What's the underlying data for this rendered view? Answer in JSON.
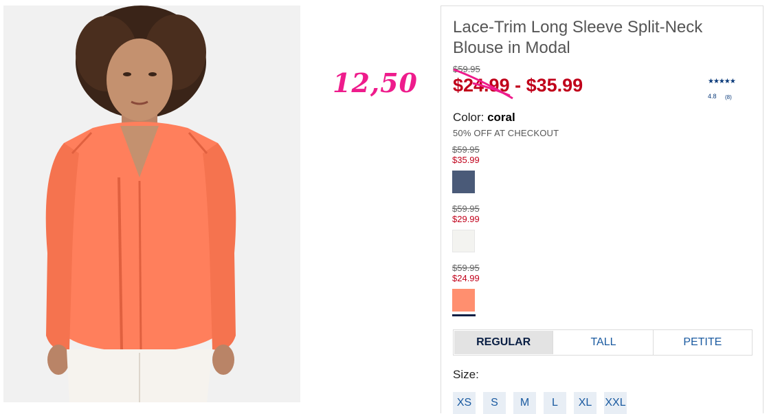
{
  "annotation": {
    "text": "12,50",
    "color": "#ee1c8c"
  },
  "product": {
    "title": "Lace-Trim Long Sleeve Split-Neck Blouse in Modal",
    "original_price": "$59.95",
    "sale_price_range": "$24.99 - $35.99",
    "rating": {
      "value": "4.8",
      "count": "(8)",
      "stars": "★★★★★"
    }
  },
  "color": {
    "label": "Color:",
    "selected": "coral",
    "promo": "50% OFF AT CHECKOUT",
    "swatches": [
      {
        "original": "$59.95",
        "sale": "$35.99",
        "color": "#4a5a78",
        "name": "navy"
      },
      {
        "original": "$59.95",
        "sale": "$29.99",
        "color": "#f3f3f0",
        "name": "white"
      },
      {
        "original": "$59.95",
        "sale": "$24.99",
        "color": "#ff8f6f",
        "name": "coral",
        "selected": true
      }
    ]
  },
  "fit": {
    "tabs": [
      "REGULAR",
      "TALL",
      "PETITE"
    ],
    "active": "REGULAR"
  },
  "size": {
    "label": "Size:",
    "options": [
      "XS",
      "S",
      "M",
      "L",
      "XL",
      "XXL"
    ]
  },
  "colors": {
    "sale_red": "#c0001a",
    "link_blue": "#1a5aa0",
    "navy": "#0a1f44"
  }
}
